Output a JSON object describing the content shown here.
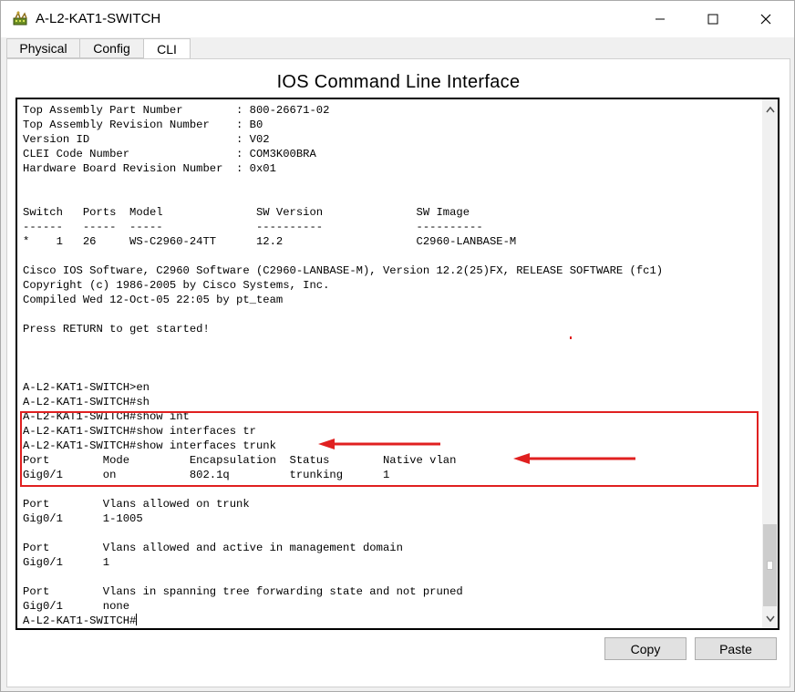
{
  "window": {
    "title": "A-L2-KAT1-SWITCH",
    "icon": "router-icon"
  },
  "tabs": [
    {
      "label": "Physical",
      "active": false
    },
    {
      "label": "Config",
      "active": false
    },
    {
      "label": "CLI",
      "active": true
    }
  ],
  "panel": {
    "title": "IOS Command Line Interface"
  },
  "terminal": {
    "lines": [
      "Top Assembly Part Number        : 800-26671-02",
      "Top Assembly Revision Number    : B0",
      "Version ID                      : V02",
      "CLEI Code Number                : COM3K00BRA",
      "Hardware Board Revision Number  : 0x01",
      "",
      "",
      "Switch   Ports  Model              SW Version              SW Image",
      "------   -----  -----              ----------              ----------",
      "*    1   26     WS-C2960-24TT      12.2                    C2960-LANBASE-M",
      "",
      "Cisco IOS Software, C2960 Software (C2960-LANBASE-M), Version 12.2(25)FX, RELEASE SOFTWARE (fc1)",
      "Copyright (c) 1986-2005 by Cisco Systems, Inc.",
      "Compiled Wed 12-Oct-05 22:05 by pt_team",
      "",
      "Press RETURN to get started!",
      "",
      "",
      "",
      "A-L2-KAT1-SWITCH>en",
      "A-L2-KAT1-SWITCH#sh",
      "A-L2-KAT1-SWITCH#show int",
      "A-L2-KAT1-SWITCH#show interfaces tr",
      "A-L2-KAT1-SWITCH#show interfaces trunk",
      "Port        Mode         Encapsulation  Status        Native vlan",
      "Gig0/1      on           802.1q         trunking      1",
      "",
      "Port        Vlans allowed on trunk",
      "Gig0/1      1-1005",
      "",
      "Port        Vlans allowed and active in management domain",
      "Gig0/1      1",
      "",
      "Port        Vlans in spanning tree forwarding state and not pruned",
      "Gig0/1      none"
    ],
    "prompt": "A-L2-KAT1-SWITCH#",
    "highlight_color": "#e02020"
  },
  "buttons": {
    "copy": "Copy",
    "paste": "Paste"
  }
}
